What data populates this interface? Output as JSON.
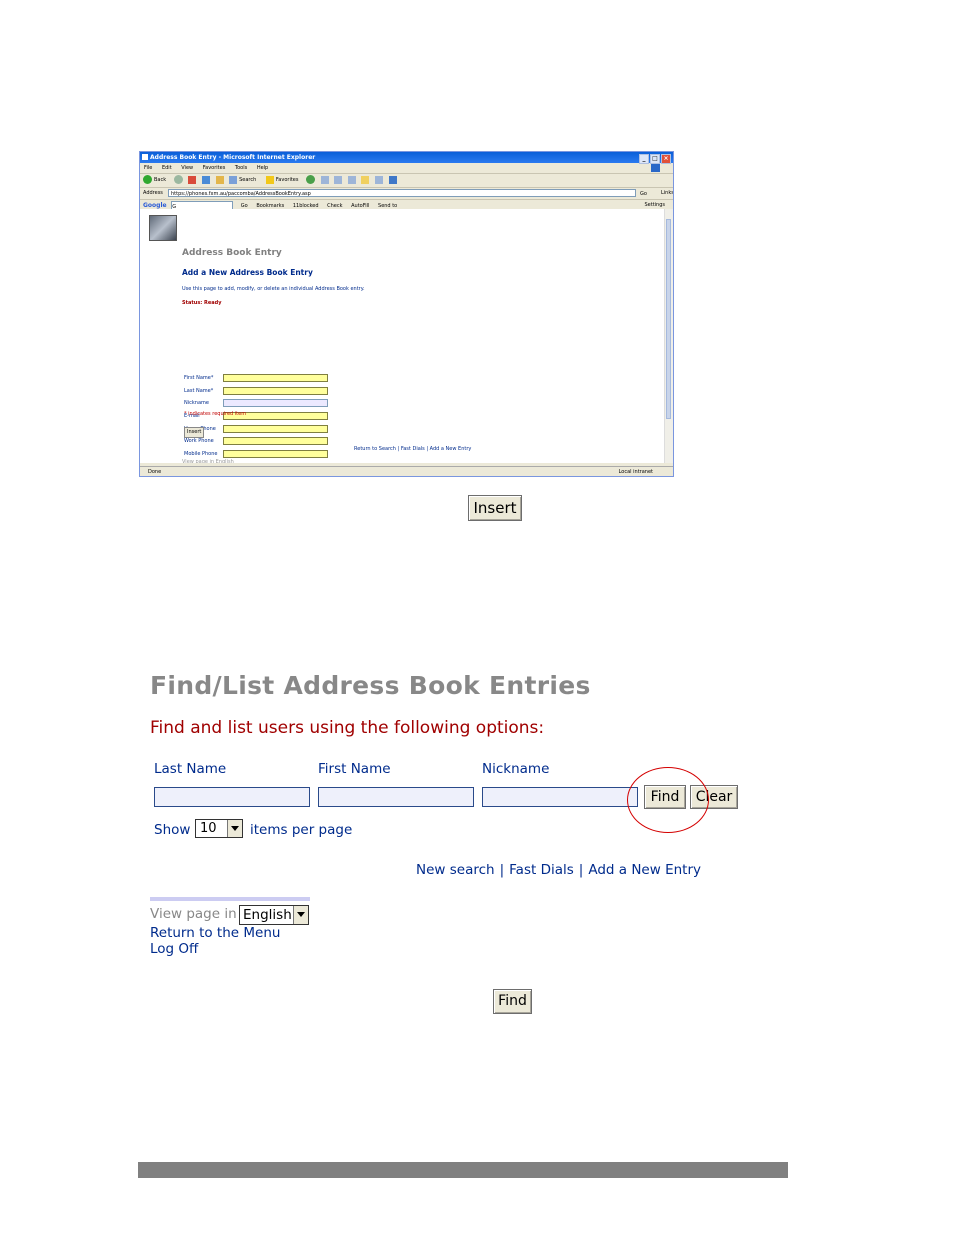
{
  "browser": {
    "window_title": "Address Book Entry - Microsoft Internet Explorer",
    "menu": [
      "File",
      "Edit",
      "View",
      "Favorites",
      "Tools",
      "Help"
    ],
    "toolbar": {
      "back": "Back",
      "search": "Search",
      "favorites": "Favorites"
    },
    "address_label": "Address",
    "address_url": "https://phones.fxm.au/paccomba/AddressBookEntry.asp",
    "go": "Go",
    "links": "Links",
    "google_toolbar": {
      "logo": "Google",
      "input_value": "G",
      "go": "Go",
      "items": [
        "Bookmarks",
        "11blocked",
        "Check",
        "AutoFill",
        "Send to"
      ],
      "settings": "Settings"
    },
    "status_left": "Done",
    "status_zone": "Local intranet"
  },
  "inner_page": {
    "title": "Address Book Entry",
    "subtitle": "Add a New Address Book Entry",
    "description": "Use this page to add, modify, or delete an individual Address Book entry.",
    "status": "Status: Ready",
    "fields": [
      {
        "label": "First Name*"
      },
      {
        "label": "Last Name*"
      },
      {
        "label": "Nickname"
      },
      {
        "label": "E-mail"
      },
      {
        "label": "Home Phone"
      },
      {
        "label": "Work Phone"
      },
      {
        "label": "Mobile Phone"
      }
    ],
    "required_note": "* indicates required item",
    "insert_label": "Insert",
    "links": "Return to Search | Fast Dials | Add a New Entry",
    "view_page": "View page in English"
  },
  "insert_button": {
    "label": "Insert"
  },
  "find_section": {
    "title": "Find/List Address Book Entries",
    "subtitle": "Find and list users using the following options:",
    "columns": [
      "Last Name",
      "First Name",
      "Nickname"
    ],
    "find_label": "Find",
    "clear_label": "Clear",
    "show_label": "Show",
    "per_page_value": "10",
    "per_page_label": "items per page",
    "nav": {
      "new_search": "New search",
      "fast_dials": "Fast Dials",
      "add_entry": "Add a New Entry",
      "separator": "|"
    },
    "view_page_label": "View page in",
    "language": "English",
    "return_menu": "Return to the Menu",
    "log_off": "Log Off"
  },
  "find_button": {
    "label": "Find"
  },
  "colors": {
    "accent_blue": "#002b8c",
    "subtitle_red": "#a00000",
    "highlight_circle": "#d40000",
    "footer_bar": "#808080"
  }
}
